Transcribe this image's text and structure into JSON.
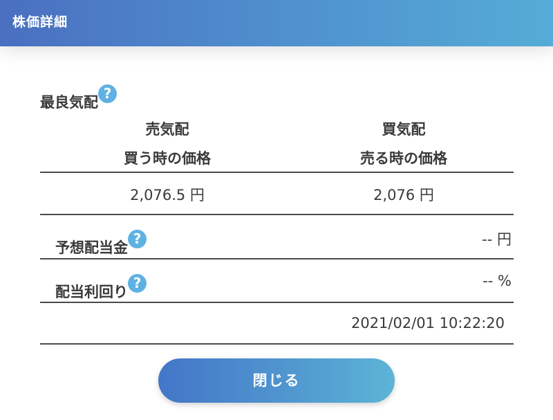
{
  "header": {
    "title": "株価詳細"
  },
  "best_quote": {
    "label": "最良気配",
    "help_icon": "?",
    "ask": {
      "label": "売気配",
      "sublabel": "買う時の価格",
      "value": "2,076.5 円"
    },
    "bid": {
      "label": "買気配",
      "sublabel": "売る時の価格",
      "value": "2,076 円"
    }
  },
  "expected_dividend": {
    "label": "予想配当金",
    "help_icon": "?",
    "value": "-- 円"
  },
  "dividend_yield": {
    "label": "配当利回り",
    "help_icon": "?",
    "value": "-- %"
  },
  "timestamp": "2021/02/01 10:22:20",
  "close_button": {
    "label": "閉じる"
  },
  "colors": {
    "header_start": "#4a6fc0",
    "header_end": "#55acd6",
    "help_icon": "#5eb2e3",
    "button_start": "#4376c8",
    "button_end": "#5cb4d6"
  }
}
